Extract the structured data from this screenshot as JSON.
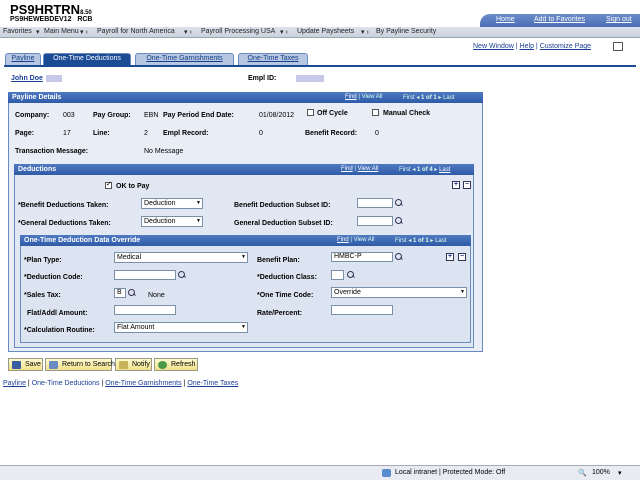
{
  "header": {
    "brand": "PS9HRTRN",
    "version": "8.50",
    "db": "PS9HEWEBDEV12",
    "user": "RCB",
    "home": "Home",
    "favorites": "Add to Favorites",
    "signout": "Sign out"
  },
  "nav": {
    "favorites": "Favorites",
    "main": "Main Menu",
    "crumbs": [
      "Payroll for North America",
      "Payroll Processing USA",
      "Update Paysheets",
      "By Payline Security"
    ]
  },
  "toplinks": {
    "new_window": "New Window",
    "help": "Help",
    "customize": "Customize Page"
  },
  "tabs": [
    "Payline",
    "One-Time Deductions",
    "One-Time Garnishments",
    "One-Time Taxes"
  ],
  "employee": {
    "name": "John Doe",
    "emplid_label": "Empl ID:"
  },
  "payline": {
    "title": "Payline Details",
    "nav_find": "Find",
    "nav_view": "View All",
    "nav_first": "First",
    "nav_count": "1 of 1",
    "nav_last": "Last",
    "company_label": "Company:",
    "company": "003",
    "paygroup_label": "Pay Group:",
    "paygroup": "EBN",
    "ped_label": "Pay Period End Date:",
    "ped": "01/08/2012",
    "offcycle": "Off Cycle",
    "manual": "Manual Check",
    "page_label": "Page:",
    "page": "17",
    "line_label": "Line:",
    "line": "2",
    "emplrec_label": "Empl Record:",
    "emplrec": "0",
    "benrec_label": "Benefit Record:",
    "benrec": "0",
    "txn_label": "Transaction Message:",
    "txn": "No Message"
  },
  "deductions": {
    "title": "Deductions",
    "nav_find": "Find",
    "nav_view": "View All",
    "nav_first": "First",
    "nav_count": "1 of 4",
    "nav_last": "Last",
    "ok_to_pay": "OK to Pay",
    "benefit_taken_label": "*Benefit Deductions Taken:",
    "benefit_taken": "Deduction",
    "benefit_subset_label": "Benefit Deduction Subset ID:",
    "general_taken_label": "*General Deductions Taken:",
    "general_taken": "Deduction",
    "general_subset_label": "General Deduction Subset ID:"
  },
  "override": {
    "title": "One-Time Deduction Data Override",
    "nav_find": "Find",
    "nav_view": "View All",
    "nav_first": "First",
    "nav_count": "1 of 1",
    "nav_last": "Last",
    "plan_type_label": "*Plan Type:",
    "plan_type": "Medical",
    "benefit_plan_label": "Benefit Plan:",
    "benefit_plan": "HMBC-P",
    "ded_code_label": "*Deduction Code:",
    "ded_class_label": "*Deduction Class:",
    "sales_tax_label": "*Sales Tax:",
    "sales_tax": "B",
    "sales_tax_desc": "None",
    "one_time_label": "*One Time Code:",
    "one_time": "Override",
    "flat_label": "Flat/Addl Amount:",
    "rate_label": "Rate/Percent:",
    "calc_label": "*Calculation Routine:",
    "calc": "Flat Amount"
  },
  "buttons": {
    "save": "Save",
    "return": "Return to Search",
    "notify": "Notify",
    "refresh": "Refresh"
  },
  "footer": [
    "Payline",
    "One-Time Deductions",
    "One-Time Garnishments",
    "One-Time Taxes"
  ],
  "status": {
    "zone": "Local intranet | Protected Mode: Off",
    "zoom": "100%"
  }
}
